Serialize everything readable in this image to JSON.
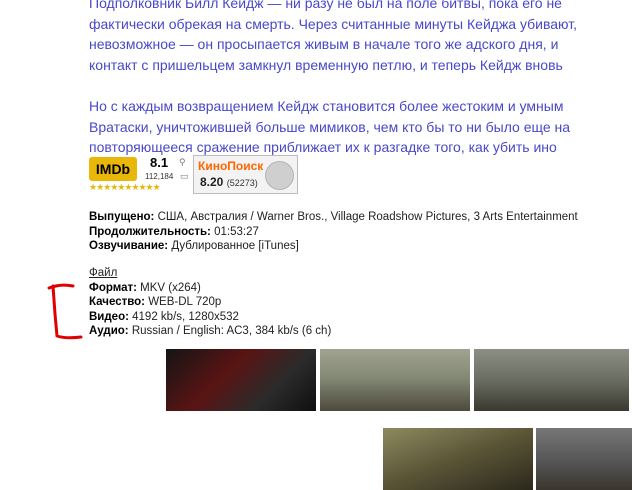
{
  "description": {
    "paragraph1": [
      "Подполковник Билл Кейдж — ни разу не был на поле битвы, пока его не",
      "фактически обрекая на смерть. Через считанные минуты Кейджа убивают,",
      "невозможное — он просыпается живым в начале того же адского дня, и",
      "контакт с пришельцем замкнул временную петлю, и теперь Кейдж вновь"
    ],
    "paragraph2": [
      "Но с каждым возвращением Кейдж становится более жестоким и умным",
      "Вратаски, уничтожившей больше мимиков, чем кто бы то ни было еще на",
      "повторяющееся сражение приближает их к разгадке того, как убить ино"
    ]
  },
  "ratings": {
    "imdb_logo": "IMDb",
    "imdb_score": "8.1",
    "imdb_votes": "112,184",
    "kp_logo": "КиноПоиск",
    "kp_score": "8.20",
    "kp_votes": "(52273)"
  },
  "meta": {
    "released_label": "Выпущено:",
    "released_value": "США, Австралия / Warner Bros., Village Roadshow Pictures, 3 Arts Entertainment",
    "duration_label": "Продолжительность:",
    "duration_value": "01:53:27",
    "dubbing_label": "Озвучивание:",
    "dubbing_value": "Дублированное [iTunes]"
  },
  "file": {
    "link_label": "Файл",
    "format_label": "Формат:",
    "format_value": "MKV (x264)",
    "quality_label": "Качество:",
    "quality_value": "WEB-DL 720p",
    "video_label": "Видео:",
    "video_value": "4192 kb/s, 1280x532",
    "audio_label": "Аудио:",
    "audio_value": "Russian / English: AC3, 384 kb/s (6 ch)"
  },
  "colors": {
    "description_text": "#4848c8",
    "imdb_yellow": "#e8b708",
    "kinopoisk_orange": "#ff6600",
    "annotation_red": "#e00000"
  }
}
